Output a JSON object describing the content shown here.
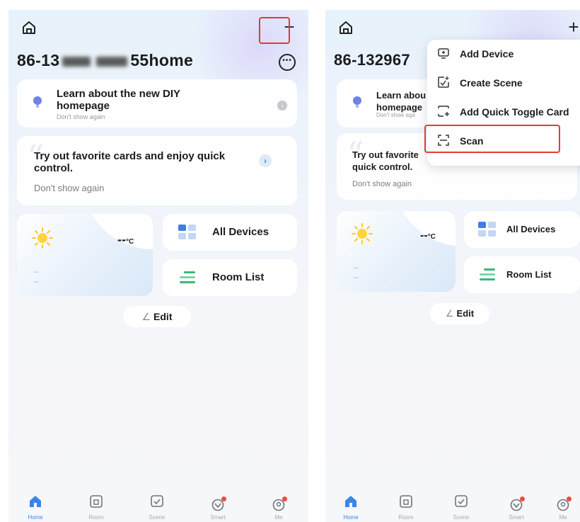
{
  "left": {
    "home_name_prefix": "86-13",
    "home_name_suffix": "55home",
    "tip_card": {
      "title": "Learn about the new DIY homepage",
      "subtitle": "Don't show again"
    },
    "favorite_card": {
      "title": "Try out favorite cards and enjoy quick control.",
      "dismiss": "Don't show again"
    },
    "weather": {
      "temp": "--",
      "unit": "°C",
      "line1": "--",
      "line2": "--"
    },
    "all_devices": "All Devices",
    "room_list": "Room List",
    "edit": "Edit"
  },
  "right": {
    "home_name": "86-132967",
    "tip_card": {
      "title": "Learn abou homepage",
      "subtitle": "Don't show aga"
    },
    "favorite_card": {
      "title": "Try out favorite quick control.",
      "dismiss": "Don't show again"
    },
    "weather": {
      "temp": "--",
      "unit": "°C",
      "line1": "--",
      "line2": "--"
    },
    "all_devices": "All Devices",
    "room_list": "Room List",
    "edit": "Edit",
    "menu": [
      {
        "label": "Add Device",
        "icon": "add-device-icon"
      },
      {
        "label": "Create Scene",
        "icon": "create-scene-icon"
      },
      {
        "label": "Add Quick Toggle Card",
        "icon": "quick-toggle-icon"
      },
      {
        "label": "Scan",
        "icon": "scan-icon"
      }
    ]
  },
  "tabs": [
    {
      "label": "Home",
      "icon": "home-tab-icon"
    },
    {
      "label": "Room",
      "icon": "room-tab-icon"
    },
    {
      "label": "Scene",
      "icon": "scene-tab-icon"
    },
    {
      "label": "Smart",
      "icon": "smart-tab-icon"
    },
    {
      "label": "Me",
      "icon": "me-tab-icon"
    }
  ],
  "colors": {
    "accent": "#3a86e8",
    "highlight": "#e03d33",
    "badge": "#ef4a3c"
  }
}
